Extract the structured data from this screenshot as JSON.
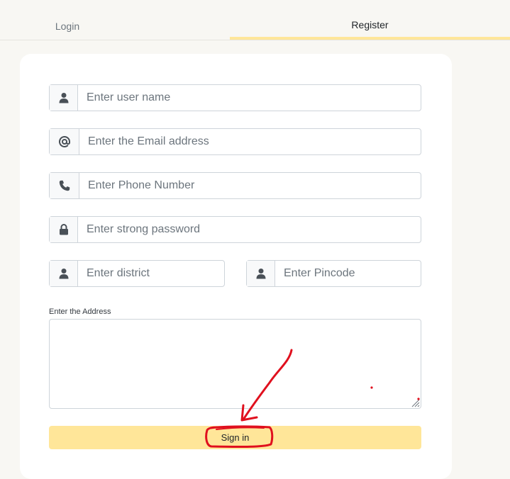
{
  "tabs": {
    "login": "Login",
    "register": "Register",
    "active": "register"
  },
  "form": {
    "username": {
      "placeholder": "Enter user name",
      "icon": "user-icon"
    },
    "email": {
      "placeholder": "Enter the Email address",
      "icon": "at-icon"
    },
    "phone": {
      "placeholder": "Enter Phone Number",
      "icon": "phone-icon"
    },
    "password": {
      "placeholder": "Enter strong password",
      "icon": "lock-icon"
    },
    "district": {
      "placeholder": "Enter district",
      "icon": "user-icon"
    },
    "pincode": {
      "placeholder": "Enter Pincode",
      "icon": "user-icon"
    },
    "address": {
      "label": "Enter the Address",
      "value": ""
    },
    "submit_label": "Sign in"
  },
  "colors": {
    "accent": "#ffe699",
    "annotation": "#e0101e",
    "background": "#f8f7f3"
  }
}
